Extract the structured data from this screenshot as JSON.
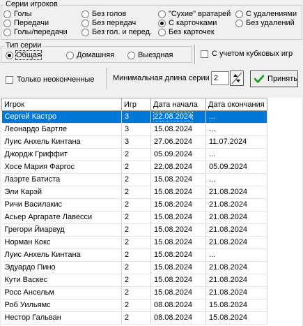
{
  "series_group": {
    "title": "Серии игроков",
    "options": [
      {
        "label": "Голы",
        "checked": false
      },
      {
        "label": "Передачи",
        "checked": false
      },
      {
        "label": "Голы/передачи",
        "checked": false
      },
      {
        "label": "Без голов",
        "checked": false
      },
      {
        "label": "Без передач",
        "checked": false
      },
      {
        "label": "Без гол. и перед.",
        "checked": false
      },
      {
        "label": "\"Сухие\" вратарей",
        "checked": false
      },
      {
        "label": "С карточками",
        "checked": true
      },
      {
        "label": "Без карточек",
        "checked": false
      },
      {
        "label": "С удалениями",
        "checked": false
      },
      {
        "label": "Без удалений",
        "checked": false
      }
    ]
  },
  "type_group": {
    "title": "Тип серии",
    "options": [
      {
        "label": "Общая",
        "checked": true
      },
      {
        "label": "Домашняя",
        "checked": false
      },
      {
        "label": "Выездная",
        "checked": false
      }
    ]
  },
  "cup_games_checkbox": {
    "label": "С учетом кубковых игр",
    "checked": false
  },
  "unfinished_checkbox": {
    "label": "Только неоконченные",
    "checked": false
  },
  "min_length": {
    "label": "Минимальная длина серии",
    "value": "2"
  },
  "apply_button": {
    "label": "Принять"
  },
  "table": {
    "columns": [
      "Игрок",
      "Игр",
      "Дата начала",
      "Дата окончания"
    ],
    "rows": [
      {
        "player": "Сергей Кастро",
        "games": "3",
        "start": "22.08.2024",
        "end": "...",
        "selected": true
      },
      {
        "player": "Леонардо Бартле",
        "games": "3",
        "start": "15.08.2024",
        "end": "..."
      },
      {
        "player": "Луис Анхель Кинтана",
        "games": "3",
        "start": "27.06.2024",
        "end": "11.07.2024"
      },
      {
        "player": "Джордж Гриффит",
        "games": "2",
        "start": "05.09.2024",
        "end": "..."
      },
      {
        "player": "Хосе Мария Фаргос",
        "games": "2",
        "start": "22.08.2024",
        "end": "05.09.2024"
      },
      {
        "player": "Лаэрте Батиста",
        "games": "2",
        "start": "15.08.2024",
        "end": "..."
      },
      {
        "player": "Эли Карэй",
        "games": "2",
        "start": "15.08.2024",
        "end": "21.08.2024"
      },
      {
        "player": "Ричи Василакис",
        "games": "2",
        "start": "15.08.2024",
        "end": "21.08.2024"
      },
      {
        "player": "Асьер Аргарате Лавесси",
        "games": "2",
        "start": "15.08.2024",
        "end": "21.08.2024"
      },
      {
        "player": "Грегори Йиарвуд",
        "games": "2",
        "start": "15.08.2024",
        "end": "21.08.2024"
      },
      {
        "player": "Норман Кокс",
        "games": "2",
        "start": "15.08.2024",
        "end": "21.08.2024"
      },
      {
        "player": "Луис Анхель Кинтана",
        "games": "2",
        "start": "15.08.2024",
        "end": "..."
      },
      {
        "player": "Эдуардо Пино",
        "games": "2",
        "start": "15.08.2024",
        "end": "21.08.2024"
      },
      {
        "player": "Кути Васкес",
        "games": "2",
        "start": "15.08.2024",
        "end": "21.08.2024"
      },
      {
        "player": "Росс Ансельм",
        "games": "2",
        "start": "15.08.2024",
        "end": "21.08.2024"
      },
      {
        "player": "Роб Уильямс",
        "games": "2",
        "start": "08.08.2024",
        "end": "15.08.2024"
      },
      {
        "player": "Нестор Гальван",
        "games": "2",
        "start": "08.08.2024",
        "end": "15.08.2024"
      }
    ]
  }
}
